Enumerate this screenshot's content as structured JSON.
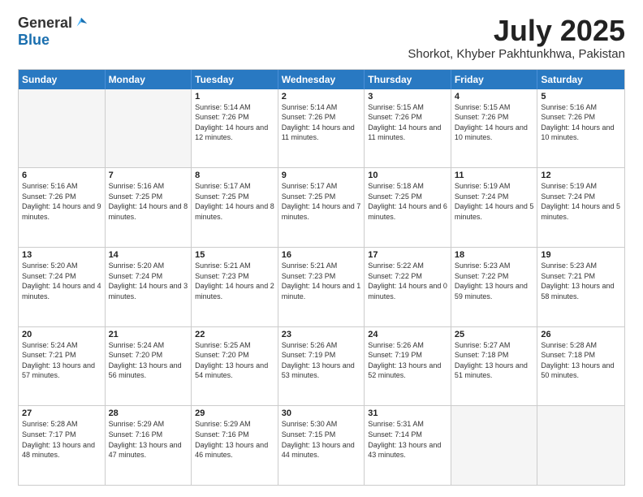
{
  "header": {
    "logo_general": "General",
    "logo_blue": "Blue",
    "month": "July 2025",
    "location": "Shorkot, Khyber Pakhtunkhwa, Pakistan"
  },
  "days": [
    "Sunday",
    "Monday",
    "Tuesday",
    "Wednesday",
    "Thursday",
    "Friday",
    "Saturday"
  ],
  "weeks": [
    [
      {
        "day": "",
        "info": ""
      },
      {
        "day": "",
        "info": ""
      },
      {
        "day": "1",
        "sunrise": "5:14 AM",
        "sunset": "7:26 PM",
        "daylight": "14 hours and 12 minutes."
      },
      {
        "day": "2",
        "sunrise": "5:14 AM",
        "sunset": "7:26 PM",
        "daylight": "14 hours and 11 minutes."
      },
      {
        "day": "3",
        "sunrise": "5:15 AM",
        "sunset": "7:26 PM",
        "daylight": "14 hours and 11 minutes."
      },
      {
        "day": "4",
        "sunrise": "5:15 AM",
        "sunset": "7:26 PM",
        "daylight": "14 hours and 10 minutes."
      },
      {
        "day": "5",
        "sunrise": "5:16 AM",
        "sunset": "7:26 PM",
        "daylight": "14 hours and 10 minutes."
      }
    ],
    [
      {
        "day": "6",
        "sunrise": "5:16 AM",
        "sunset": "7:26 PM",
        "daylight": "14 hours and 9 minutes."
      },
      {
        "day": "7",
        "sunrise": "5:16 AM",
        "sunset": "7:25 PM",
        "daylight": "14 hours and 8 minutes."
      },
      {
        "day": "8",
        "sunrise": "5:17 AM",
        "sunset": "7:25 PM",
        "daylight": "14 hours and 8 minutes."
      },
      {
        "day": "9",
        "sunrise": "5:17 AM",
        "sunset": "7:25 PM",
        "daylight": "14 hours and 7 minutes."
      },
      {
        "day": "10",
        "sunrise": "5:18 AM",
        "sunset": "7:25 PM",
        "daylight": "14 hours and 6 minutes."
      },
      {
        "day": "11",
        "sunrise": "5:19 AM",
        "sunset": "7:24 PM",
        "daylight": "14 hours and 5 minutes."
      },
      {
        "day": "12",
        "sunrise": "5:19 AM",
        "sunset": "7:24 PM",
        "daylight": "14 hours and 5 minutes."
      }
    ],
    [
      {
        "day": "13",
        "sunrise": "5:20 AM",
        "sunset": "7:24 PM",
        "daylight": "14 hours and 4 minutes."
      },
      {
        "day": "14",
        "sunrise": "5:20 AM",
        "sunset": "7:24 PM",
        "daylight": "14 hours and 3 minutes."
      },
      {
        "day": "15",
        "sunrise": "5:21 AM",
        "sunset": "7:23 PM",
        "daylight": "14 hours and 2 minutes."
      },
      {
        "day": "16",
        "sunrise": "5:21 AM",
        "sunset": "7:23 PM",
        "daylight": "14 hours and 1 minute."
      },
      {
        "day": "17",
        "sunrise": "5:22 AM",
        "sunset": "7:22 PM",
        "daylight": "14 hours and 0 minutes."
      },
      {
        "day": "18",
        "sunrise": "5:23 AM",
        "sunset": "7:22 PM",
        "daylight": "13 hours and 59 minutes."
      },
      {
        "day": "19",
        "sunrise": "5:23 AM",
        "sunset": "7:21 PM",
        "daylight": "13 hours and 58 minutes."
      }
    ],
    [
      {
        "day": "20",
        "sunrise": "5:24 AM",
        "sunset": "7:21 PM",
        "daylight": "13 hours and 57 minutes."
      },
      {
        "day": "21",
        "sunrise": "5:24 AM",
        "sunset": "7:20 PM",
        "daylight": "13 hours and 56 minutes."
      },
      {
        "day": "22",
        "sunrise": "5:25 AM",
        "sunset": "7:20 PM",
        "daylight": "13 hours and 54 minutes."
      },
      {
        "day": "23",
        "sunrise": "5:26 AM",
        "sunset": "7:19 PM",
        "daylight": "13 hours and 53 minutes."
      },
      {
        "day": "24",
        "sunrise": "5:26 AM",
        "sunset": "7:19 PM",
        "daylight": "13 hours and 52 minutes."
      },
      {
        "day": "25",
        "sunrise": "5:27 AM",
        "sunset": "7:18 PM",
        "daylight": "13 hours and 51 minutes."
      },
      {
        "day": "26",
        "sunrise": "5:28 AM",
        "sunset": "7:18 PM",
        "daylight": "13 hours and 50 minutes."
      }
    ],
    [
      {
        "day": "27",
        "sunrise": "5:28 AM",
        "sunset": "7:17 PM",
        "daylight": "13 hours and 48 minutes."
      },
      {
        "day": "28",
        "sunrise": "5:29 AM",
        "sunset": "7:16 PM",
        "daylight": "13 hours and 47 minutes."
      },
      {
        "day": "29",
        "sunrise": "5:29 AM",
        "sunset": "7:16 PM",
        "daylight": "13 hours and 46 minutes."
      },
      {
        "day": "30",
        "sunrise": "5:30 AM",
        "sunset": "7:15 PM",
        "daylight": "13 hours and 44 minutes."
      },
      {
        "day": "31",
        "sunrise": "5:31 AM",
        "sunset": "7:14 PM",
        "daylight": "13 hours and 43 minutes."
      },
      {
        "day": "",
        "info": ""
      },
      {
        "day": "",
        "info": ""
      }
    ]
  ]
}
